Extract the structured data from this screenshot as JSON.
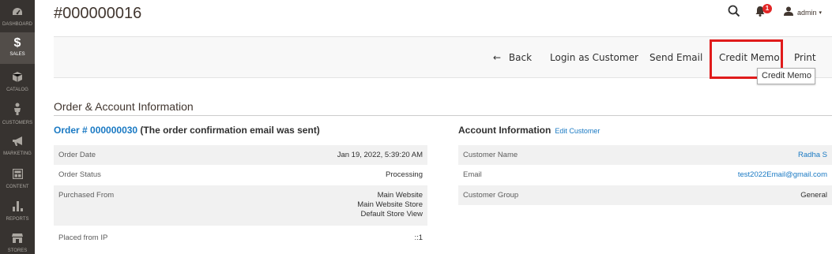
{
  "sidebar": {
    "items": [
      {
        "label": "DASHBOARD",
        "icon": "dashboard-icon"
      },
      {
        "label": "SALES",
        "icon": "dollar-icon",
        "active": true
      },
      {
        "label": "CATALOG",
        "icon": "cube-icon"
      },
      {
        "label": "CUSTOMERS",
        "icon": "person-icon"
      },
      {
        "label": "MARKETING",
        "icon": "megaphone-icon"
      },
      {
        "label": "CONTENT",
        "icon": "layout-icon"
      },
      {
        "label": "REPORTS",
        "icon": "bar-chart-icon"
      },
      {
        "label": "STORES",
        "icon": "store-icon"
      }
    ]
  },
  "header": {
    "title": "#000000016",
    "notifications_count": "1",
    "user_name": "admin",
    "caret": "▾"
  },
  "toolbar": {
    "back_label": "Back",
    "back_arrow": "←",
    "login_label": "Login as Customer",
    "email_label": "Send Email",
    "credit_label": "Credit Memo",
    "print_label": "Print",
    "tooltip": "Credit Memo"
  },
  "section": {
    "title": "Order & Account Information"
  },
  "order": {
    "link_text": "Order # 000000030",
    "note": " (The order confirmation email was sent)",
    "rows": [
      {
        "label": "Order Date",
        "value": [
          "Jan 19, 2022, 5:39:20 AM"
        ]
      },
      {
        "label": "Order Status",
        "value": [
          "Processing"
        ]
      },
      {
        "label": "Purchased From",
        "value": [
          "Main Website",
          "Main Website Store",
          "Default Store View"
        ]
      },
      {
        "label": "Placed from IP",
        "value": [
          "::1"
        ]
      }
    ]
  },
  "account": {
    "title": "Account Information",
    "edit_label": "Edit Customer",
    "rows": [
      {
        "label": "Customer Name",
        "value": "Radha S",
        "link": true
      },
      {
        "label": "Email",
        "value": "test2022Email@gmail.com",
        "link": true
      },
      {
        "label": "Customer Group",
        "value": "General",
        "link": false
      }
    ]
  },
  "colors": {
    "sidebar_bg": "#373330",
    "link": "#1979c3",
    "highlight": "#e01b1b",
    "badge": "#e22626"
  }
}
